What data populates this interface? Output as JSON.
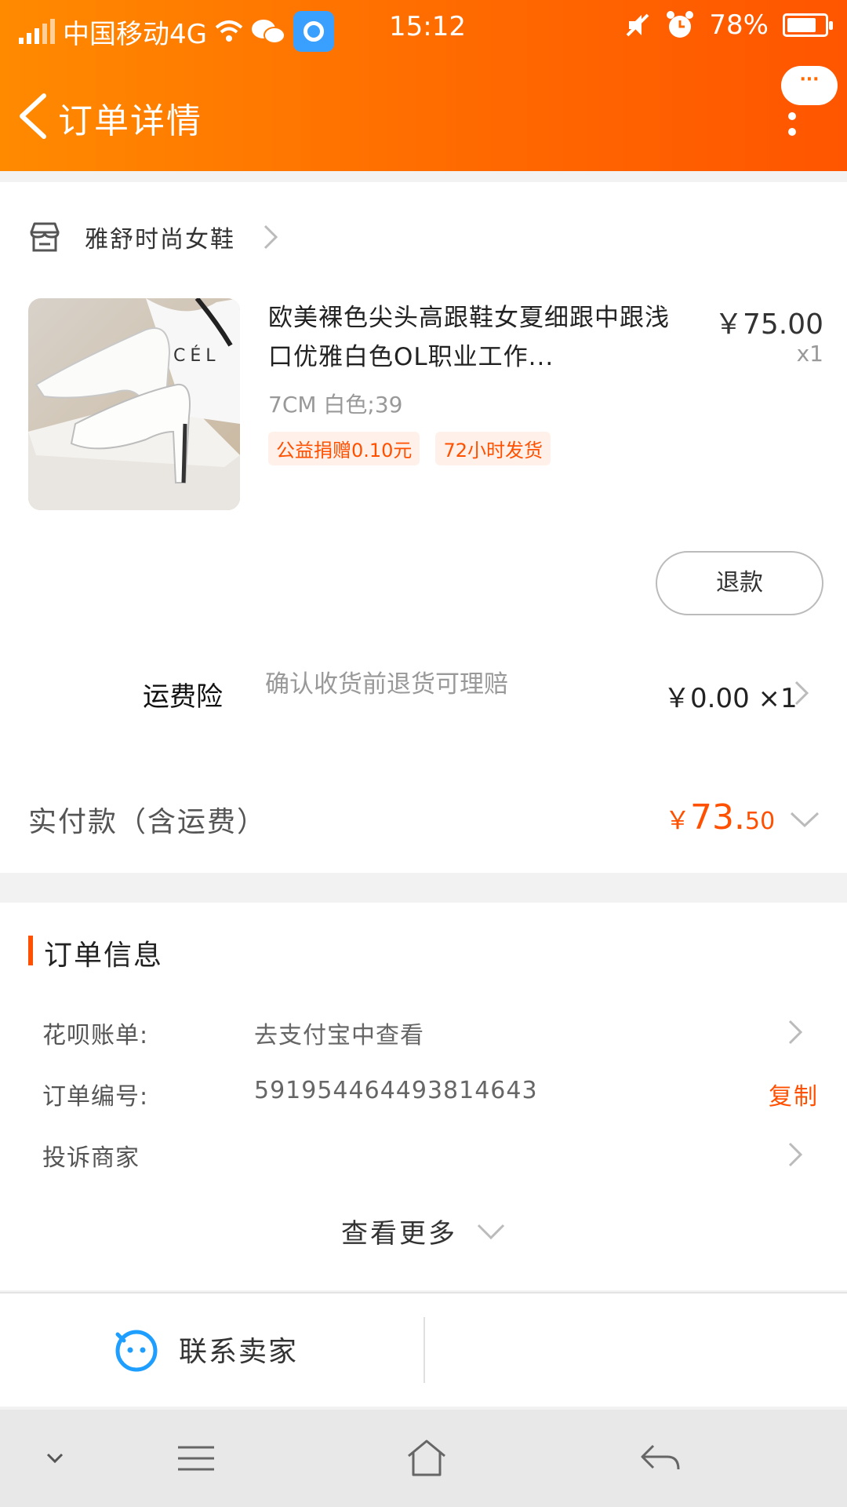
{
  "status_bar": {
    "carrier": "中国移动4G",
    "time": "15:12",
    "battery": "78%"
  },
  "nav": {
    "title": "订单详情",
    "chat_label": "···"
  },
  "shop": {
    "name": "雅舒时尚女鞋"
  },
  "product": {
    "title": "欧美裸色尖头高跟鞋女夏细跟中跟浅口优雅白色OL职业工作...",
    "price": "￥75.00",
    "qty": "x1",
    "sku": "7CM 白色;39",
    "tags": [
      "公益捐赠0.10元",
      "72小时发货"
    ],
    "image_text": "CÉL"
  },
  "refund_button": "退款",
  "shipping_insurance": {
    "label": "运费险",
    "desc": "确认收货前退货可理赔",
    "price": "￥0.00 ×1"
  },
  "paid": {
    "label": "实付款（含运费）",
    "currency": "￥",
    "amount_int": "73.",
    "amount_dec": "50"
  },
  "order_info": {
    "title": "订单信息",
    "rows": [
      {
        "key": "花呗账单:",
        "value": "去支付宝中查看"
      },
      {
        "key": "订单编号:",
        "value": "591954464493814643",
        "action": "复制"
      },
      {
        "key": "投诉商家",
        "value": ""
      }
    ],
    "see_more": "查看更多"
  },
  "bottom": {
    "contact_seller": "联系卖家"
  },
  "colors": {
    "accent": "#ff5000",
    "header_start": "#ff8a00",
    "header_end": "#ff5500"
  }
}
